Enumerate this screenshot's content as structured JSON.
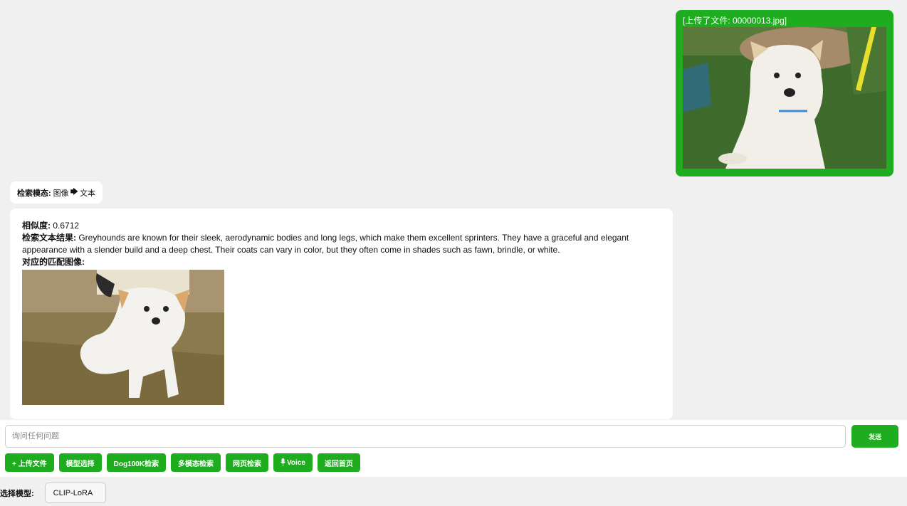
{
  "user_message": {
    "caption": "[上传了文件: 00000013.jpg]"
  },
  "mode_pill": {
    "label": "检索模态:",
    "from": "图像",
    "arrow": "🡆",
    "to": "文本"
  },
  "result": {
    "similarity_label": "相似度:",
    "similarity_value": "0.6712",
    "text_result_label": "检索文本结果:",
    "text_result_value": "Greyhounds are known for their sleek, aerodynamic bodies and long legs, which make them excellent sprinters. They have a graceful and elegant appearance with a slender build and a deep chest. Their coats can vary in color, but they often come in shades such as fawn, brindle, or white.",
    "matched_image_label": "对应的匹配图像:"
  },
  "input": {
    "placeholder": "询问任何问题",
    "value": ""
  },
  "send_button": "发送",
  "toolbar": {
    "upload": "+ 上传文件",
    "model_select": "模型选择",
    "dog100k": "Dog100K检索",
    "multimodal": "多模态检索",
    "web": "网页检索",
    "voice": "Voice",
    "home": "返回首页"
  },
  "model": {
    "label": "选择模型:",
    "selected": "CLIP-LoRA"
  },
  "colors": {
    "accent": "#1ead1e",
    "background": "#f0f0f0",
    "bubble": "#ffffff"
  }
}
